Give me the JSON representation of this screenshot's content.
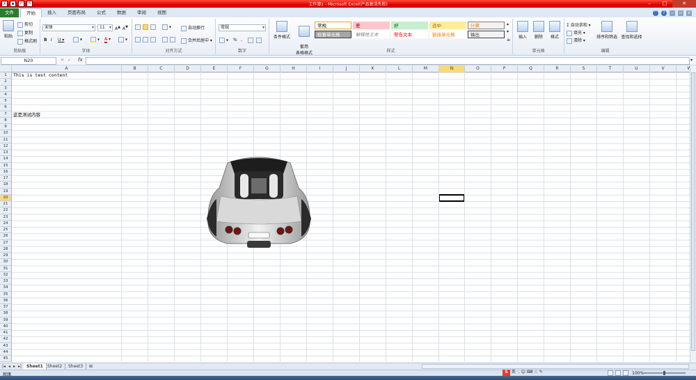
{
  "window": {
    "title": "工作簿1 - Microsoft Excel(产品激活失败)"
  },
  "ribbon_tabs": [
    "文件",
    "开始",
    "插入",
    "页面布局",
    "公式",
    "数据",
    "审阅",
    "视图"
  ],
  "clipboard": {
    "paste": "粘贴",
    "cut": "剪切",
    "copy": "复制",
    "format_painter": "格式刷",
    "group_label": "剪贴板"
  },
  "font": {
    "family_value": "宋体",
    "size_value": "11",
    "group_label": "字体"
  },
  "alignment": {
    "wrap_text": "自动换行",
    "merge_center": "合并后居中",
    "group_label": "对齐方式"
  },
  "number": {
    "format_value": "常规",
    "group_label": "数字"
  },
  "styles": {
    "conditional_format": "条件格式",
    "format_as_table": "套用\n表格格式",
    "cells": [
      {
        "label": "常规",
        "bg": "#ffffff",
        "fg": "#000000",
        "border": "#e0a63a"
      },
      {
        "label": "差",
        "bg": "#ffc7ce",
        "fg": "#9c0006",
        "border": "#ffc7ce"
      },
      {
        "label": "好",
        "bg": "#c6efce",
        "fg": "#006100",
        "border": "#c6efce"
      },
      {
        "label": "适中",
        "bg": "#ffeb9c",
        "fg": "#9c6500",
        "border": "#ffeb9c"
      },
      {
        "label": "计算",
        "bg": "#f2f2f2",
        "fg": "#fa7d00",
        "border": "#7f7f7f"
      },
      {
        "label": "检查单元格",
        "bg": "#a5a5a5",
        "fg": "#ffffff",
        "border": "#3f3f3f"
      },
      {
        "label": "解释性文本",
        "bg": "#ffffff",
        "fg": "#7f7f7f",
        "border": "#ffffff"
      },
      {
        "label": "警告文本",
        "bg": "#ffffff",
        "fg": "#ff0000",
        "border": "#ffffff"
      },
      {
        "label": "链接单元格",
        "bg": "#ffffff",
        "fg": "#fa7d00",
        "border": "#ffffff"
      },
      {
        "label": "输出",
        "bg": "#f2f2f2",
        "fg": "#3f3f3f",
        "border": "#3f3f3f"
      }
    ],
    "group_label": "样式"
  },
  "cells_group": {
    "insert": "插入",
    "delete": "删除",
    "format": "格式",
    "group_label": "单元格"
  },
  "editing": {
    "autosum": "自动求和",
    "fill": "填充",
    "clear": "清除",
    "sort_filter": "排序和筛选",
    "find_select": "查找和选择",
    "group_label": "编辑"
  },
  "formula_bar": {
    "name_box": "N20",
    "fx": "fx",
    "content": ""
  },
  "columns": [
    "A",
    "B",
    "C",
    "D",
    "E",
    "F",
    "G",
    "H",
    "I",
    "J",
    "K",
    "L",
    "M",
    "N",
    "O",
    "P",
    "Q",
    "R",
    "S",
    "T",
    "U",
    "V",
    "W"
  ],
  "rows": [
    "1",
    "2",
    "3",
    "4",
    "5",
    "6",
    "7",
    "8",
    "9",
    "10",
    "11",
    "12",
    "13",
    "14",
    "15",
    "16",
    "17",
    "18",
    "19",
    "20",
    "21",
    "22",
    "23",
    "24",
    "25",
    "26",
    "27",
    "28",
    "29",
    "30",
    "31",
    "32",
    "33",
    "34",
    "35",
    "36",
    "37",
    "38",
    "39",
    "40",
    "41",
    "42",
    "43",
    "44",
    "45"
  ],
  "selected_cell": {
    "column": "N",
    "row": "20"
  },
  "cell_values": {
    "A1": "This is test content",
    "A7": "这是测试内容"
  },
  "sheets": [
    "Sheet1",
    "Sheet2",
    "Sheet3"
  ],
  "status": {
    "ready": "就绪",
    "zoom": "100%"
  },
  "ime": {
    "mode": "英"
  },
  "colors": {
    "title_bar": "#e40000",
    "file_tab": "#2b7d2f",
    "selected_header": "#f8d978"
  }
}
